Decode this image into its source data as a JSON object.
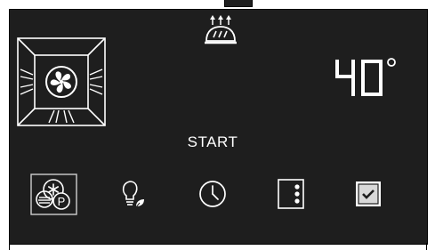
{
  "display": {
    "temperature_value": "40",
    "temperature_unit": "°",
    "start_label": "START"
  },
  "icons": {
    "top_heating": "bread-top-heat-icon",
    "fan_heating": "oven-fan-icon",
    "mode": "fan-proof-mode-icon",
    "mode_badge": "P",
    "light": "light-bulb-eco-icon",
    "timer": "clock-icon",
    "menu": "menu-dots-icon",
    "confirm": "checkbox-icon"
  },
  "colors": {
    "panel_background": "#1e1e1e",
    "foreground": "#ffffff",
    "selected_frame": "#cfcfcf",
    "confirm_fill": "#d9d9d9"
  }
}
